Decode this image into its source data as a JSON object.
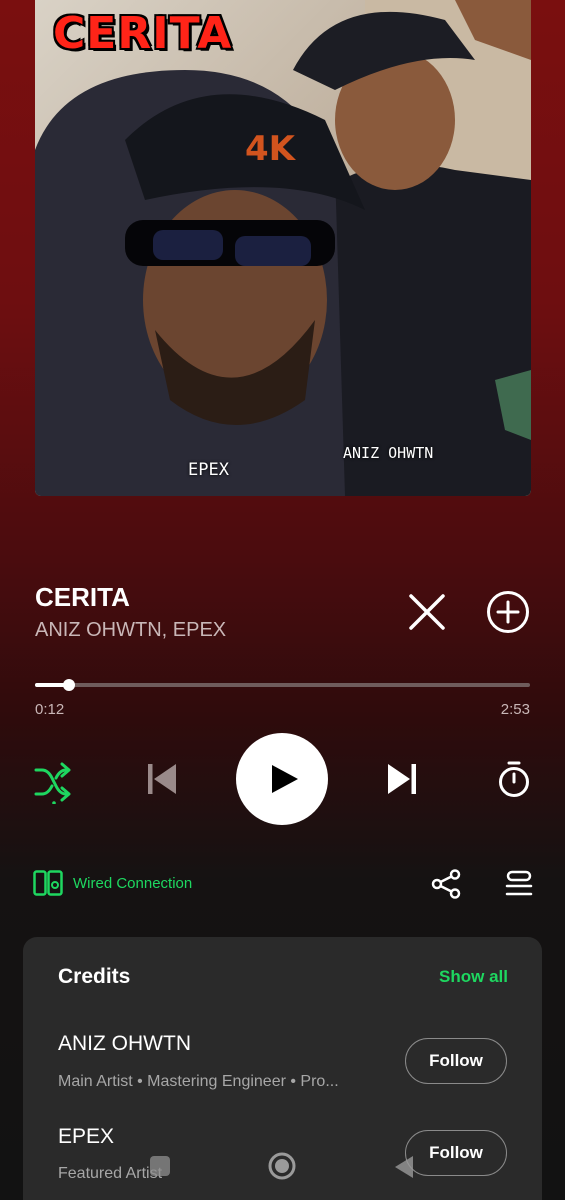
{
  "album_art": {
    "title_text": "CERITA",
    "caption_left": "EPEX",
    "caption_right": "ANIZ OHWTN"
  },
  "track": {
    "title": "CERITA",
    "artists": "ANIZ OHWTN, EPEX"
  },
  "playback": {
    "elapsed": "0:12",
    "duration": "2:53",
    "progress_fraction": 0.069
  },
  "controls": {
    "shuffle_icon": "shuffle-icon",
    "previous_icon": "skip-previous-icon",
    "play_icon": "play-icon",
    "next_icon": "skip-next-icon",
    "timer_icon": "sleep-timer-icon",
    "remove_icon": "close-icon",
    "add_icon": "add-circle-icon"
  },
  "device": {
    "label": "Wired Connection",
    "icon": "connect-device-icon"
  },
  "actions": {
    "share_icon": "share-icon",
    "queue_icon": "queue-icon"
  },
  "credits": {
    "title": "Credits",
    "show_all": "Show all",
    "items": [
      {
        "name": "ANIZ OHWTN",
        "role": "Main Artist • Mastering Engineer • Pro...",
        "follow": "Follow"
      },
      {
        "name": "EPEX",
        "role": "Featured Artist",
        "follow": "Follow"
      }
    ]
  },
  "colors": {
    "accent_green": "#1ed760",
    "background_top": "#7a0f0f",
    "background_bottom": "#121212",
    "card": "#2a2a2a"
  }
}
